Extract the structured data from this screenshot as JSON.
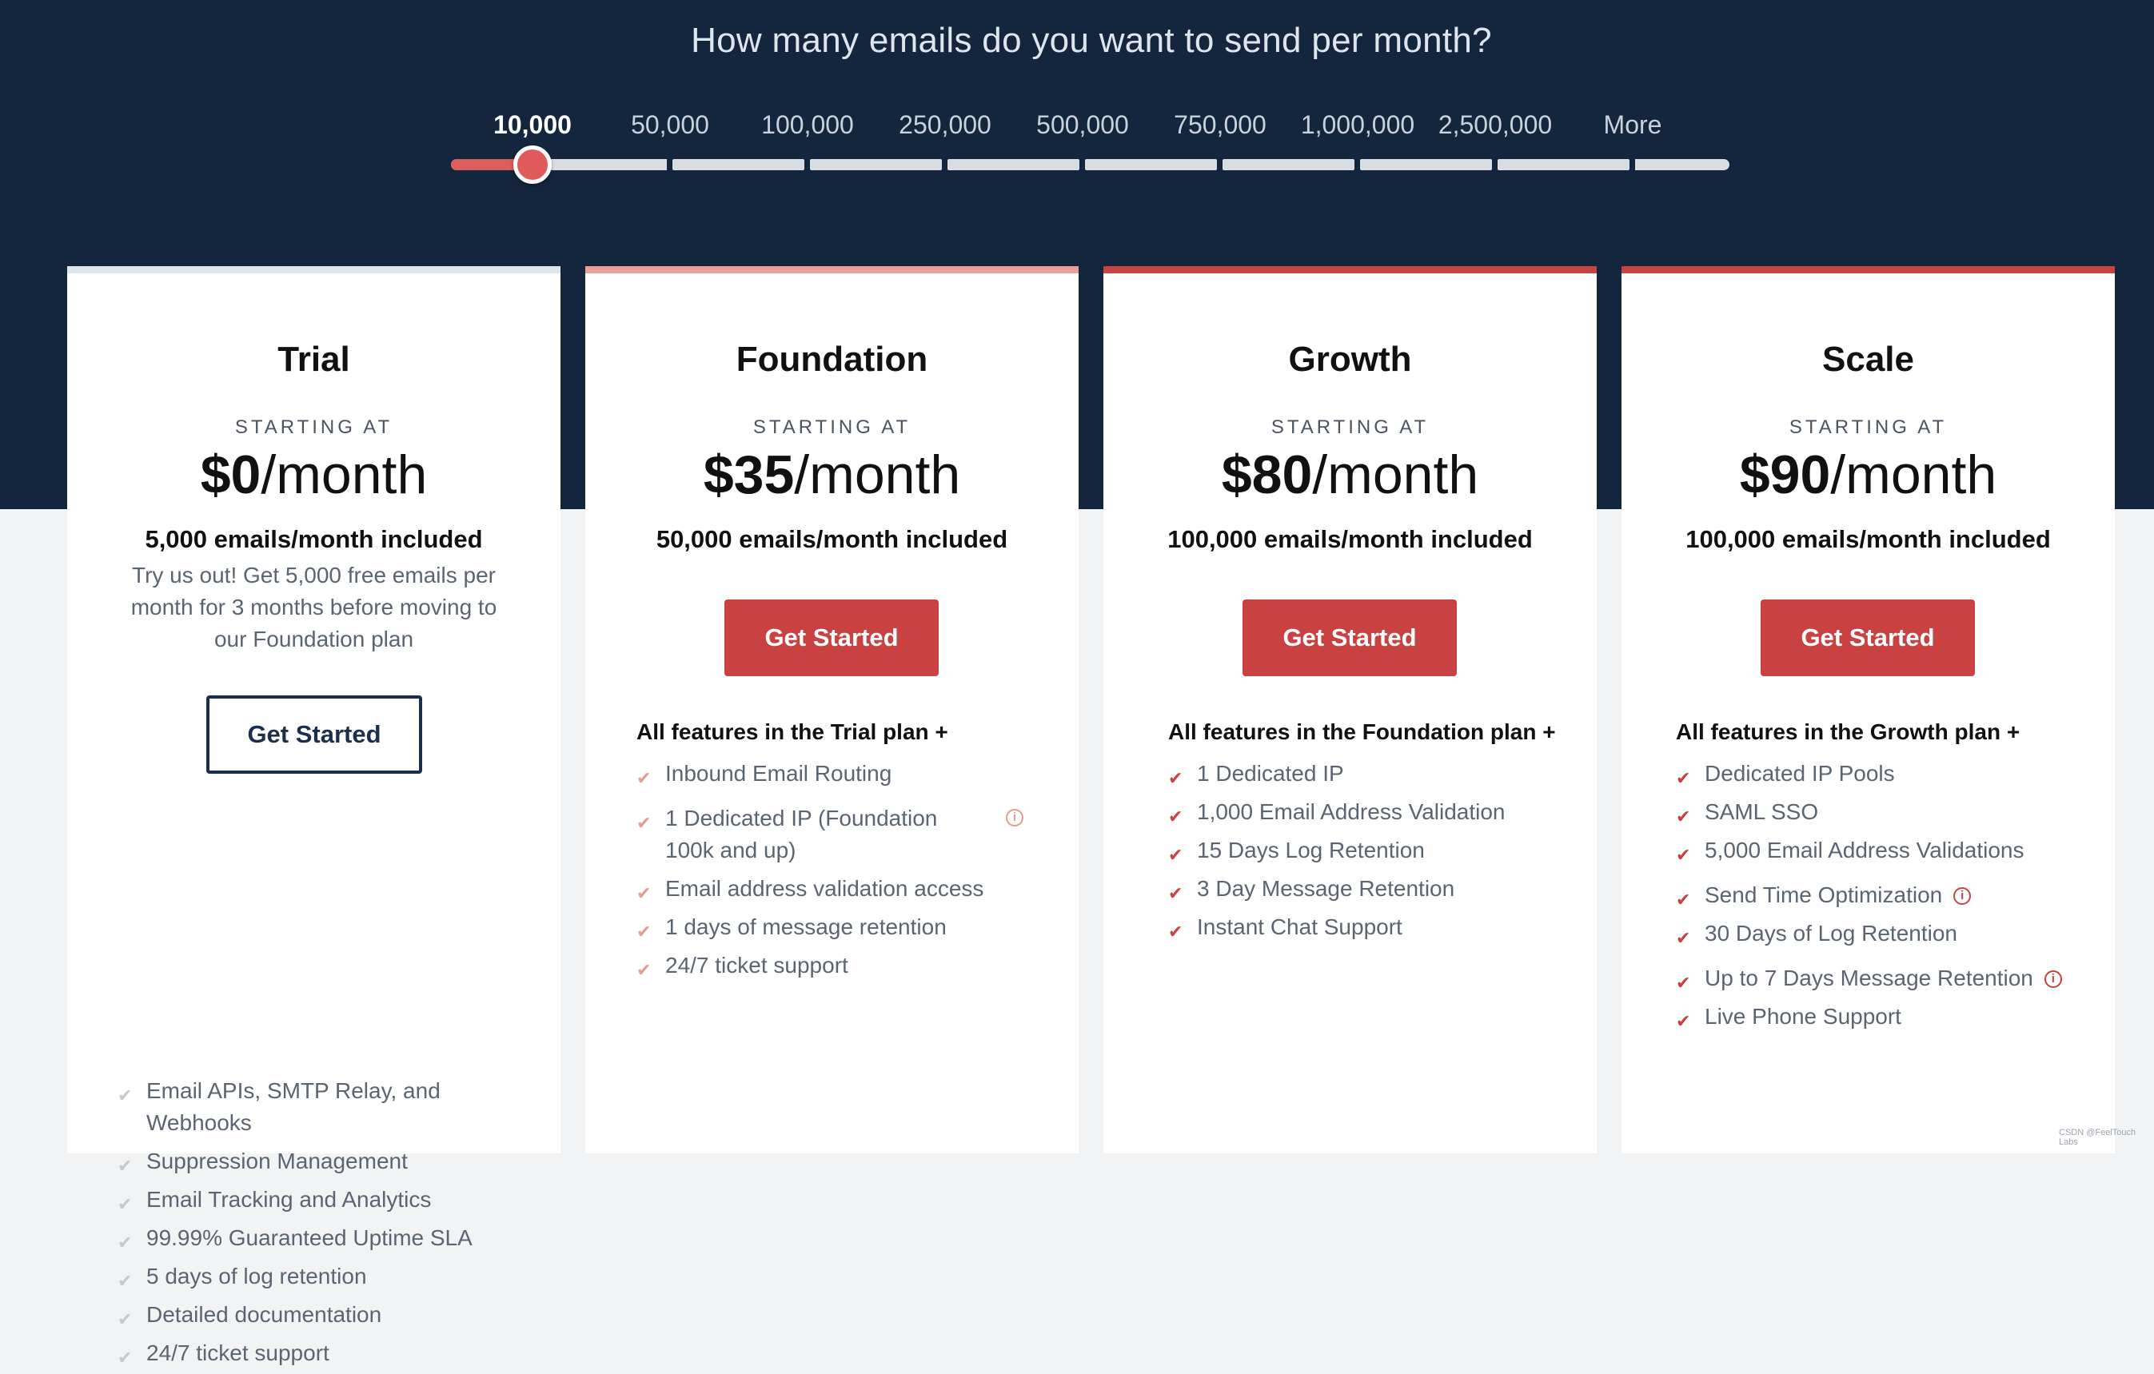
{
  "hero": {
    "question": "How many emails do you want to send per month?",
    "slider": {
      "options": [
        "10,000",
        "50,000",
        "100,000",
        "250,000",
        "500,000",
        "750,000",
        "1,000,000",
        "2,500,000",
        "More"
      ],
      "selected": "10,000"
    }
  },
  "plans": [
    {
      "name": "Trial",
      "starting_at": "STARTING AT",
      "price": "$0",
      "unit": "/month",
      "included": "5,000 emails/month included",
      "description": "Try us out! Get 5,000 free emails per month for 3 months before moving to our Foundation plan",
      "cta": "Get Started",
      "features": [
        "Email APIs, SMTP Relay, and Webhooks",
        "Suppression Management",
        "Email Tracking and Analytics",
        "99.99% Guaranteed Uptime SLA",
        "5 days of log retention",
        "Detailed documentation",
        "24/7 ticket support"
      ]
    },
    {
      "name": "Foundation",
      "starting_at": "STARTING AT",
      "price": "$35",
      "unit": "/month",
      "included": "50,000 emails/month included",
      "cta": "Get Started",
      "features_heading": "All features in the Trial plan +",
      "features": [
        "Inbound Email Routing",
        "1 Dedicated IP (Foundation 100k and up)",
        "Email address validation access",
        "1 days of message retention",
        "24/7 ticket support"
      ]
    },
    {
      "name": "Growth",
      "starting_at": "STARTING AT",
      "price": "$80",
      "unit": "/month",
      "included": "100,000 emails/month included",
      "cta": "Get Started",
      "features_heading": "All features in the Foundation plan +",
      "features": [
        "1 Dedicated IP",
        "1,000 Email Address Validation",
        "15 Days Log Retention",
        "3 Day Message Retention",
        "Instant Chat Support"
      ]
    },
    {
      "name": "Scale",
      "starting_at": "STARTING AT",
      "price": "$90",
      "unit": "/month",
      "included": "100,000 emails/month included",
      "cta": "Get Started",
      "features_heading": "All features in the Growth plan +",
      "features": [
        "Dedicated IP Pools",
        "SAML SSO",
        "5,000 Email Address Validations",
        "Send Time Optimization",
        "30 Days of Log Retention",
        "Up to 7 Days Message Retention",
        "Live Phone Support"
      ]
    }
  ],
  "icons": {
    "check": "check-icon",
    "info": "info-icon"
  },
  "colors": {
    "hero_bg": "#13263d",
    "accent_red": "#c94241",
    "check_light": "#e79a8f",
    "check_gray": "#c4c9cf",
    "outline_navy": "#1b2f4c"
  },
  "watermark": "CSDN @FeelTouch Labs"
}
